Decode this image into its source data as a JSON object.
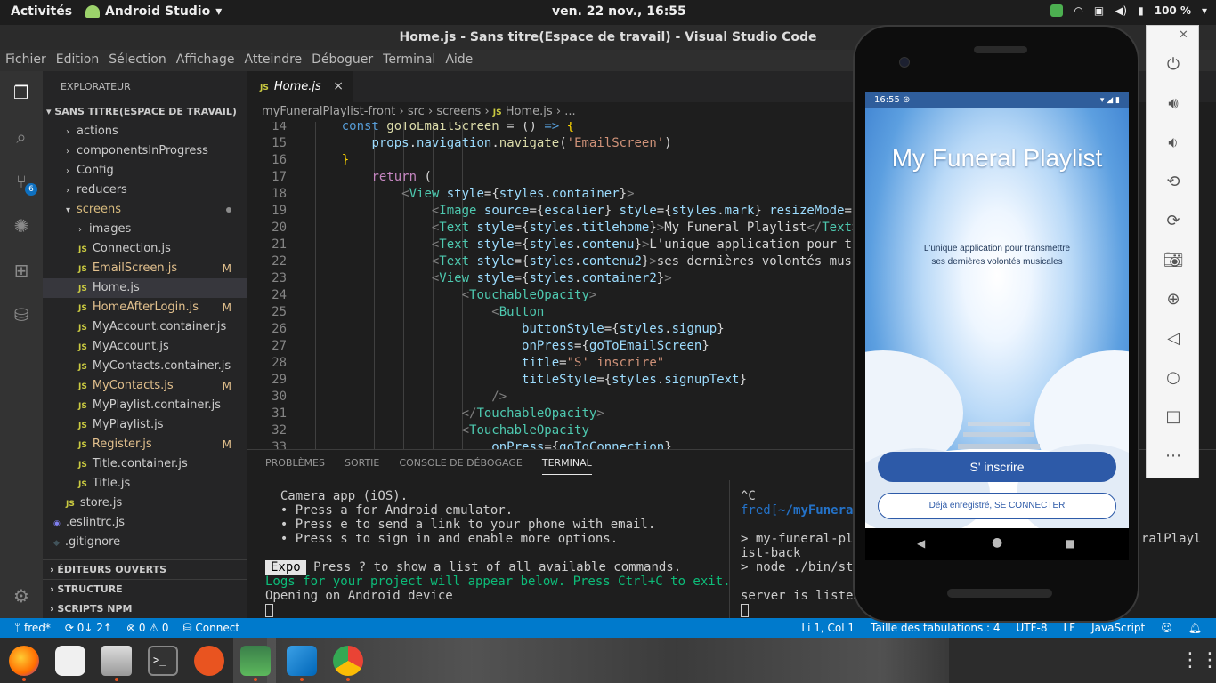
{
  "topbar": {
    "activities": "Activités",
    "app_name": "Android Studio",
    "clock": "ven. 22 nov., 16:55",
    "battery": "100 %"
  },
  "window_title": "Home.js - Sans titre(Espace de travail) - Visual Studio Code",
  "menu": [
    "Fichier",
    "Edition",
    "Sélection",
    "Affichage",
    "Atteindre",
    "Déboguer",
    "Terminal",
    "Aide"
  ],
  "activity_badge": "6",
  "explorer": {
    "title": "EXPLORATEUR",
    "workspace": "SANS TITRE(ESPACE DE TRAVAIL)",
    "items": [
      {
        "name": "actions",
        "type": "folder",
        "indent": 1
      },
      {
        "name": "componentsInProgress",
        "type": "folder",
        "indent": 1
      },
      {
        "name": "Config",
        "type": "folder",
        "indent": 1
      },
      {
        "name": "reducers",
        "type": "folder",
        "indent": 1
      },
      {
        "name": "screens",
        "type": "folder-open",
        "indent": 1,
        "dot": true
      },
      {
        "name": "images",
        "type": "folder",
        "indent": 2
      },
      {
        "name": "Connection.js",
        "type": "js",
        "indent": 2
      },
      {
        "name": "EmailScreen.js",
        "type": "js",
        "indent": 2,
        "mark": "M"
      },
      {
        "name": "Home.js",
        "type": "js",
        "indent": 2,
        "selected": true
      },
      {
        "name": "HomeAfterLogin.js",
        "type": "js",
        "indent": 2,
        "mark": "M"
      },
      {
        "name": "MyAccount.container.js",
        "type": "js",
        "indent": 2
      },
      {
        "name": "MyAccount.js",
        "type": "js",
        "indent": 2
      },
      {
        "name": "MyContacts.container.js",
        "type": "js",
        "indent": 2
      },
      {
        "name": "MyContacts.js",
        "type": "js",
        "indent": 2,
        "mark": "M"
      },
      {
        "name": "MyPlaylist.container.js",
        "type": "js",
        "indent": 2
      },
      {
        "name": "MyPlaylist.js",
        "type": "js",
        "indent": 2
      },
      {
        "name": "Register.js",
        "type": "js",
        "indent": 2,
        "mark": "M"
      },
      {
        "name": "Title.container.js",
        "type": "js",
        "indent": 2
      },
      {
        "name": "Title.js",
        "type": "js",
        "indent": 2
      },
      {
        "name": "store.js",
        "type": "js",
        "indent": 1
      },
      {
        "name": ".eslintrc.js",
        "type": "eslint",
        "indent": 0
      },
      {
        "name": ".gitignore",
        "type": "git",
        "indent": 0
      }
    ],
    "sections": [
      "ÉDITEURS OUVERTS",
      "STRUCTURE",
      "SCRIPTS NPM"
    ]
  },
  "editor": {
    "tab_label": "Home.js",
    "breadcrumb": [
      "myFuneralPlaylist-front",
      "src",
      "screens",
      "Home.js",
      "..."
    ],
    "lines": [
      {
        "n": "14",
        "indent": 0,
        "parts": [
          [
            "k",
            "const "
          ],
          [
            "f",
            "goToEmailScreen"
          ],
          [
            "w",
            " = () "
          ],
          [
            "k",
            "=>"
          ],
          [
            "w",
            " "
          ],
          [
            "br",
            "{"
          ]
        ]
      },
      {
        "n": "15",
        "indent": 1,
        "parts": [
          [
            "v",
            "props"
          ],
          [
            "w",
            "."
          ],
          [
            "v",
            "navigation"
          ],
          [
            "w",
            "."
          ],
          [
            "f",
            "navigate"
          ],
          [
            "w",
            "("
          ],
          [
            "s",
            "'EmailScreen'"
          ],
          [
            "w",
            ")"
          ]
        ]
      },
      {
        "n": "16",
        "indent": 0,
        "parts": [
          [
            "br",
            "}"
          ]
        ]
      },
      {
        "n": "17",
        "indent": 1,
        "parts": [
          [
            "kw",
            "return"
          ],
          [
            "w",
            " ("
          ]
        ]
      },
      {
        "n": "18",
        "indent": 2,
        "parts": [
          [
            "p",
            "<"
          ],
          [
            "t",
            "View"
          ],
          [
            "w",
            " "
          ],
          [
            "v",
            "style"
          ],
          [
            "w",
            "={"
          ],
          [
            "v",
            "styles"
          ],
          [
            "w",
            "."
          ],
          [
            "v",
            "container"
          ],
          [
            "w",
            "}"
          ],
          [
            "p",
            ">"
          ]
        ]
      },
      {
        "n": "19",
        "indent": 3,
        "parts": [
          [
            "p",
            "<"
          ],
          [
            "t",
            "Image"
          ],
          [
            "w",
            " "
          ],
          [
            "v",
            "source"
          ],
          [
            "w",
            "={"
          ],
          [
            "v",
            "escalier"
          ],
          [
            "w",
            "} "
          ],
          [
            "v",
            "style"
          ],
          [
            "w",
            "={"
          ],
          [
            "v",
            "styles"
          ],
          [
            "w",
            "."
          ],
          [
            "v",
            "mark"
          ],
          [
            "w",
            "} "
          ],
          [
            "v",
            "resizeMode"
          ],
          [
            "w",
            "="
          ],
          [
            "s",
            "'"
          ]
        ]
      },
      {
        "n": "20",
        "indent": 3,
        "parts": [
          [
            "p",
            "<"
          ],
          [
            "t",
            "Text"
          ],
          [
            "w",
            " "
          ],
          [
            "v",
            "style"
          ],
          [
            "w",
            "={"
          ],
          [
            "v",
            "styles"
          ],
          [
            "w",
            "."
          ],
          [
            "v",
            "titlehome"
          ],
          [
            "w",
            "}"
          ],
          [
            "p",
            ">"
          ],
          [
            "w",
            "My Funeral Playlist"
          ],
          [
            "p",
            "</"
          ],
          [
            "t",
            "Text"
          ],
          [
            "p",
            ">"
          ]
        ]
      },
      {
        "n": "21",
        "indent": 3,
        "parts": [
          [
            "p",
            "<"
          ],
          [
            "t",
            "Text"
          ],
          [
            "w",
            " "
          ],
          [
            "v",
            "style"
          ],
          [
            "w",
            "={"
          ],
          [
            "v",
            "styles"
          ],
          [
            "w",
            "."
          ],
          [
            "v",
            "contenu"
          ],
          [
            "w",
            "}"
          ],
          [
            "p",
            ">"
          ],
          [
            "w",
            "L'unique application pour tr"
          ]
        ]
      },
      {
        "n": "22",
        "indent": 3,
        "parts": [
          [
            "p",
            "<"
          ],
          [
            "t",
            "Text"
          ],
          [
            "w",
            " "
          ],
          [
            "v",
            "style"
          ],
          [
            "w",
            "={"
          ],
          [
            "v",
            "styles"
          ],
          [
            "w",
            "."
          ],
          [
            "v",
            "contenu2"
          ],
          [
            "w",
            "}"
          ],
          [
            "p",
            ">"
          ],
          [
            "w",
            "ses dernières volontés musi"
          ]
        ]
      },
      {
        "n": "23",
        "indent": 3,
        "parts": [
          [
            "p",
            "<"
          ],
          [
            "t",
            "View"
          ],
          [
            "w",
            " "
          ],
          [
            "v",
            "style"
          ],
          [
            "w",
            "={"
          ],
          [
            "v",
            "styles"
          ],
          [
            "w",
            "."
          ],
          [
            "v",
            "container2"
          ],
          [
            "w",
            "}"
          ],
          [
            "p",
            ">"
          ]
        ]
      },
      {
        "n": "24",
        "indent": 4,
        "parts": [
          [
            "p",
            "<"
          ],
          [
            "t",
            "TouchableOpacity"
          ],
          [
            "p",
            ">"
          ]
        ]
      },
      {
        "n": "25",
        "indent": 5,
        "parts": [
          [
            "p",
            "<"
          ],
          [
            "t",
            "Button"
          ]
        ]
      },
      {
        "n": "26",
        "indent": 6,
        "parts": [
          [
            "v",
            "buttonStyle"
          ],
          [
            "w",
            "={"
          ],
          [
            "v",
            "styles"
          ],
          [
            "w",
            "."
          ],
          [
            "v",
            "signup"
          ],
          [
            "w",
            "}"
          ]
        ]
      },
      {
        "n": "27",
        "indent": 6,
        "parts": [
          [
            "v",
            "onPress"
          ],
          [
            "w",
            "={"
          ],
          [
            "v",
            "goToEmailScreen"
          ],
          [
            "w",
            "}"
          ]
        ]
      },
      {
        "n": "28",
        "indent": 6,
        "parts": [
          [
            "v",
            "title"
          ],
          [
            "w",
            "="
          ],
          [
            "s",
            "\"S' inscrire\""
          ]
        ]
      },
      {
        "n": "29",
        "indent": 6,
        "parts": [
          [
            "v",
            "titleStyle"
          ],
          [
            "w",
            "={"
          ],
          [
            "v",
            "styles"
          ],
          [
            "w",
            "."
          ],
          [
            "v",
            "signupText"
          ],
          [
            "w",
            "}"
          ]
        ]
      },
      {
        "n": "30",
        "indent": 5,
        "parts": [
          [
            "p",
            "/>"
          ]
        ]
      },
      {
        "n": "31",
        "indent": 4,
        "parts": [
          [
            "p",
            "</"
          ],
          [
            "t",
            "TouchableOpacity"
          ],
          [
            "p",
            ">"
          ]
        ]
      },
      {
        "n": "32",
        "indent": 4,
        "parts": [
          [
            "p",
            "<"
          ],
          [
            "t",
            "TouchableOpacity"
          ]
        ]
      },
      {
        "n": "33",
        "indent": 5,
        "parts": [
          [
            "v",
            "onPress"
          ],
          [
            "w",
            "={"
          ],
          [
            "v",
            "goToConnection"
          ],
          [
            "w",
            "}"
          ]
        ]
      }
    ]
  },
  "panel": {
    "tabs": [
      "PROBLÈMES",
      "SORTIE",
      "CONSOLE DE DÉBOGAGE",
      "TERMINAL"
    ],
    "active_tab": "TERMINAL",
    "term_left": {
      "line1": "  Camera app (iOS).",
      "bullet_a": "  • Press a for Android emulator.",
      "bullet_e": "  • Press e to send a link to your phone with email.",
      "bullet_s": "  • Press s to sign in and enable more options.",
      "expo_badge": "Expo",
      "help": " Press ? to show a list of all available commands.",
      "logs": "Logs for your project will appear below. Press Ctrl+C to exit.",
      "opening": "Opening on Android device"
    },
    "term_right": {
      "ctrl": "^C",
      "prompt_user": "fred[",
      "prompt_path": "~/myFuneral",
      "cmd1": "> my-funeral-pla",
      "cmd1_tail": "ralPlayl",
      "cmd1_wrap": "ist-back",
      "cmd2": "> node ./bin/sta",
      "server": "server is listen"
    }
  },
  "statusbar": {
    "branch": "fred*",
    "sync": "0↓ 2↑",
    "problems": "⊗ 0 ⚠ 0",
    "connect": "Connect",
    "position": "Li 1, Col 1",
    "tabsize": "Taille des tabulations : 4",
    "encoding": "UTF-8",
    "eol": "LF",
    "language": "JavaScript"
  },
  "emulator": {
    "phone_time": "16:55",
    "app_title": "My Funeral Playlist",
    "app_subtitle_1": "L'unique application pour transmettre",
    "app_subtitle_2": "ses dernières volontés musicales",
    "signup_label": "S' inscrire",
    "login_label": "Déjà enregistré, SE CONNECTER"
  },
  "colors": {
    "vscode_blue": "#007acc",
    "button_blue": "#2d5aa8",
    "editor_bg": "#1e1e1e",
    "sidebar_bg": "#252526"
  }
}
